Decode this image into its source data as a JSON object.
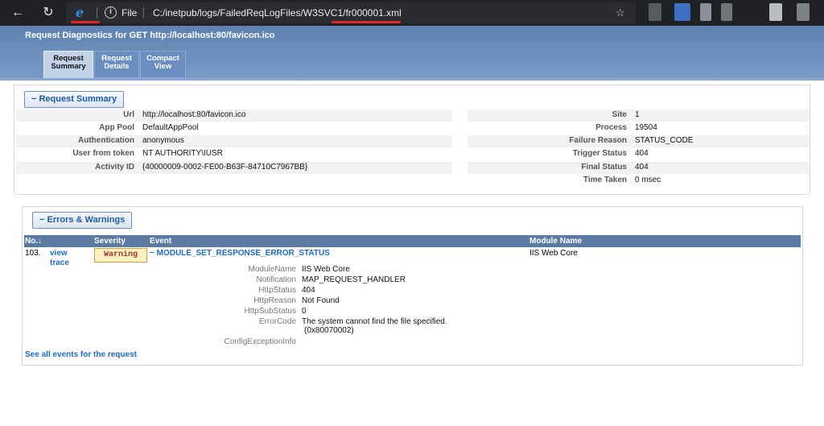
{
  "browser": {
    "file_label": "File",
    "address": "C:/inetpub/logs/FailedReqLogFiles/W3SVC1/fr000001.xml"
  },
  "header": {
    "title": "Request Diagnostics for GET http://localhost:80/favicon.ico",
    "tabs": [
      {
        "label": "Request Summary",
        "active": true
      },
      {
        "label": "Request Details",
        "active": false
      },
      {
        "label": "Compact View",
        "active": false
      }
    ]
  },
  "summary": {
    "section_label": "− Request Summary",
    "left": [
      {
        "label": "Url",
        "value": "http://localhost:80/favicon.ico"
      },
      {
        "label": "App Pool",
        "value": "DefaultAppPool"
      },
      {
        "label": "Authentication",
        "value": "anonymous"
      },
      {
        "label": "User from token",
        "value": "NT AUTHORITY\\IUSR"
      },
      {
        "label": "Activity ID",
        "value": "{40000009-0002-FE00-B63F-84710C7967BB}"
      }
    ],
    "right": [
      {
        "label": "Site",
        "value": "1"
      },
      {
        "label": "Process",
        "value": "19504"
      },
      {
        "label": "Failure Reason",
        "value": "STATUS_CODE"
      },
      {
        "label": "Trigger Status",
        "value": "404"
      },
      {
        "label": "Final Status",
        "value": "404"
      },
      {
        "label": "Time Taken",
        "value": "0 msec"
      }
    ]
  },
  "errors": {
    "section_label": "− Errors & Warnings",
    "columns": {
      "no": "No.↓",
      "severity": "Severity",
      "event": "Event",
      "module": "Module Name"
    },
    "row": {
      "no": "103.",
      "view_trace_1": "view",
      "view_trace_2": "trace",
      "severity": "Warning",
      "event": "− MODULE_SET_RESPONSE_ERROR_STATUS",
      "module": "IIS Web Core"
    },
    "details": [
      {
        "label": "ModuleName",
        "value": "IIS Web Core"
      },
      {
        "label": "Notification",
        "value": "MAP_REQUEST_HANDLER"
      },
      {
        "label": "HttpStatus",
        "value": "404"
      },
      {
        "label": "HttpReason",
        "value": "Not Found"
      },
      {
        "label": "HttpSubStatus",
        "value": "0"
      },
      {
        "label": "ErrorCode",
        "value": "The system cannot find the file specified."
      },
      {
        "label": "",
        "value": "(0x80070002)"
      },
      {
        "label": "ConfigExceptionInfo",
        "value": ""
      }
    ],
    "see_all": "See all events for the request"
  },
  "colors": {
    "header": "#5d82b0",
    "link": "#1b6ac9",
    "table_head": "#5b7ba3",
    "warning_bg": "#fbf2c0"
  }
}
